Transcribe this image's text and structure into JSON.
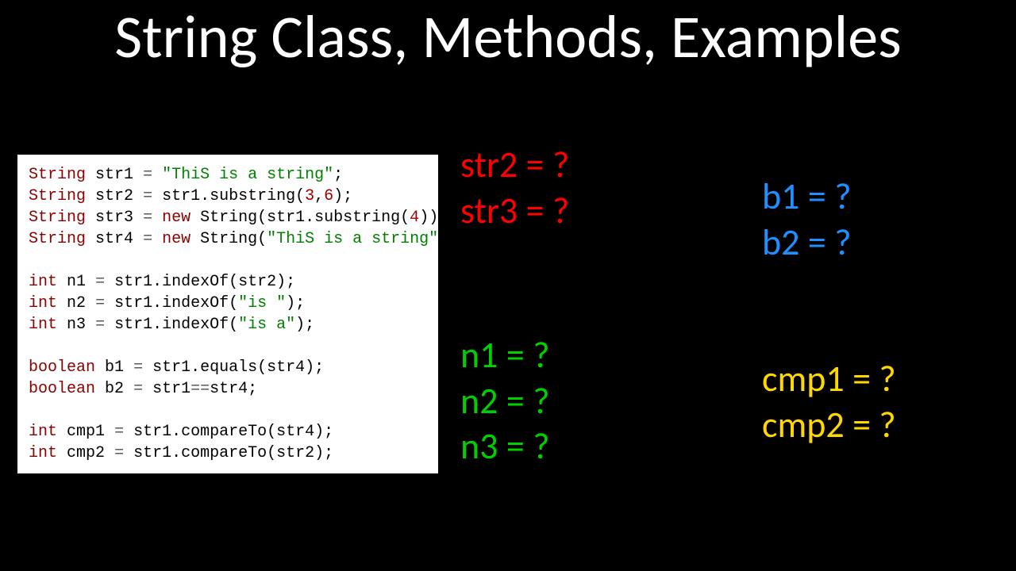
{
  "title": "String Class, Methods, Examples",
  "code": {
    "l1": {
      "type": "String",
      "id": "str1",
      "eq": "=",
      "str": "\"ThiS is a string\"",
      "semi": ";"
    },
    "l2": {
      "type": "String",
      "id": "str2",
      "eq": "=",
      "expr": "str1.substring(",
      "n1": "3",
      "c": ",",
      "n2": "6",
      "end": ");"
    },
    "l3": {
      "type": "String",
      "id": "str3",
      "eq": "=",
      "kw": "new",
      "call": "String(str1.substring(",
      "n": "4",
      "end": "));"
    },
    "l4": {
      "type": "String",
      "id": "str4",
      "eq": "=",
      "kw": "new",
      "call": "String(",
      "str": "\"ThiS is a string\"",
      "end": ");"
    },
    "l5": {
      "type": "int",
      "id": "n1",
      "eq": "=",
      "expr": "str1.indexOf(str2);"
    },
    "l6": {
      "type": "int",
      "id": "n2",
      "eq": "=",
      "expr": "str1.indexOf(",
      "str": "\"is \"",
      "end": ");"
    },
    "l7": {
      "type": "int",
      "id": "n3",
      "eq": "=",
      "expr": "str1.indexOf(",
      "str": "\"is a\"",
      "end": ");"
    },
    "l8": {
      "type": "boolean",
      "id": "b1",
      "eq": "=",
      "expr": "str1.equals(str4);"
    },
    "l9": {
      "type": "boolean",
      "id": "b2",
      "eq": "=",
      "expr": "str1",
      "op": "==",
      "expr2": "str4;"
    },
    "l10": {
      "type": "int",
      "id": "cmp1",
      "eq": "=",
      "expr": "str1.compareTo(str4);"
    },
    "l11": {
      "type": "int",
      "id": "cmp2",
      "eq": "=",
      "expr": "str1.compareTo(str2);"
    }
  },
  "q": {
    "str2": "str2 = ?",
    "str3": "str3 = ?",
    "n1": "n1 = ?",
    "n2": "n2 = ?",
    "n3": "n3 = ?",
    "b1": "b1 = ?",
    "b2": "b2 = ?",
    "cmp1": "cmp1 = ?",
    "cmp2": "cmp2 = ?"
  }
}
